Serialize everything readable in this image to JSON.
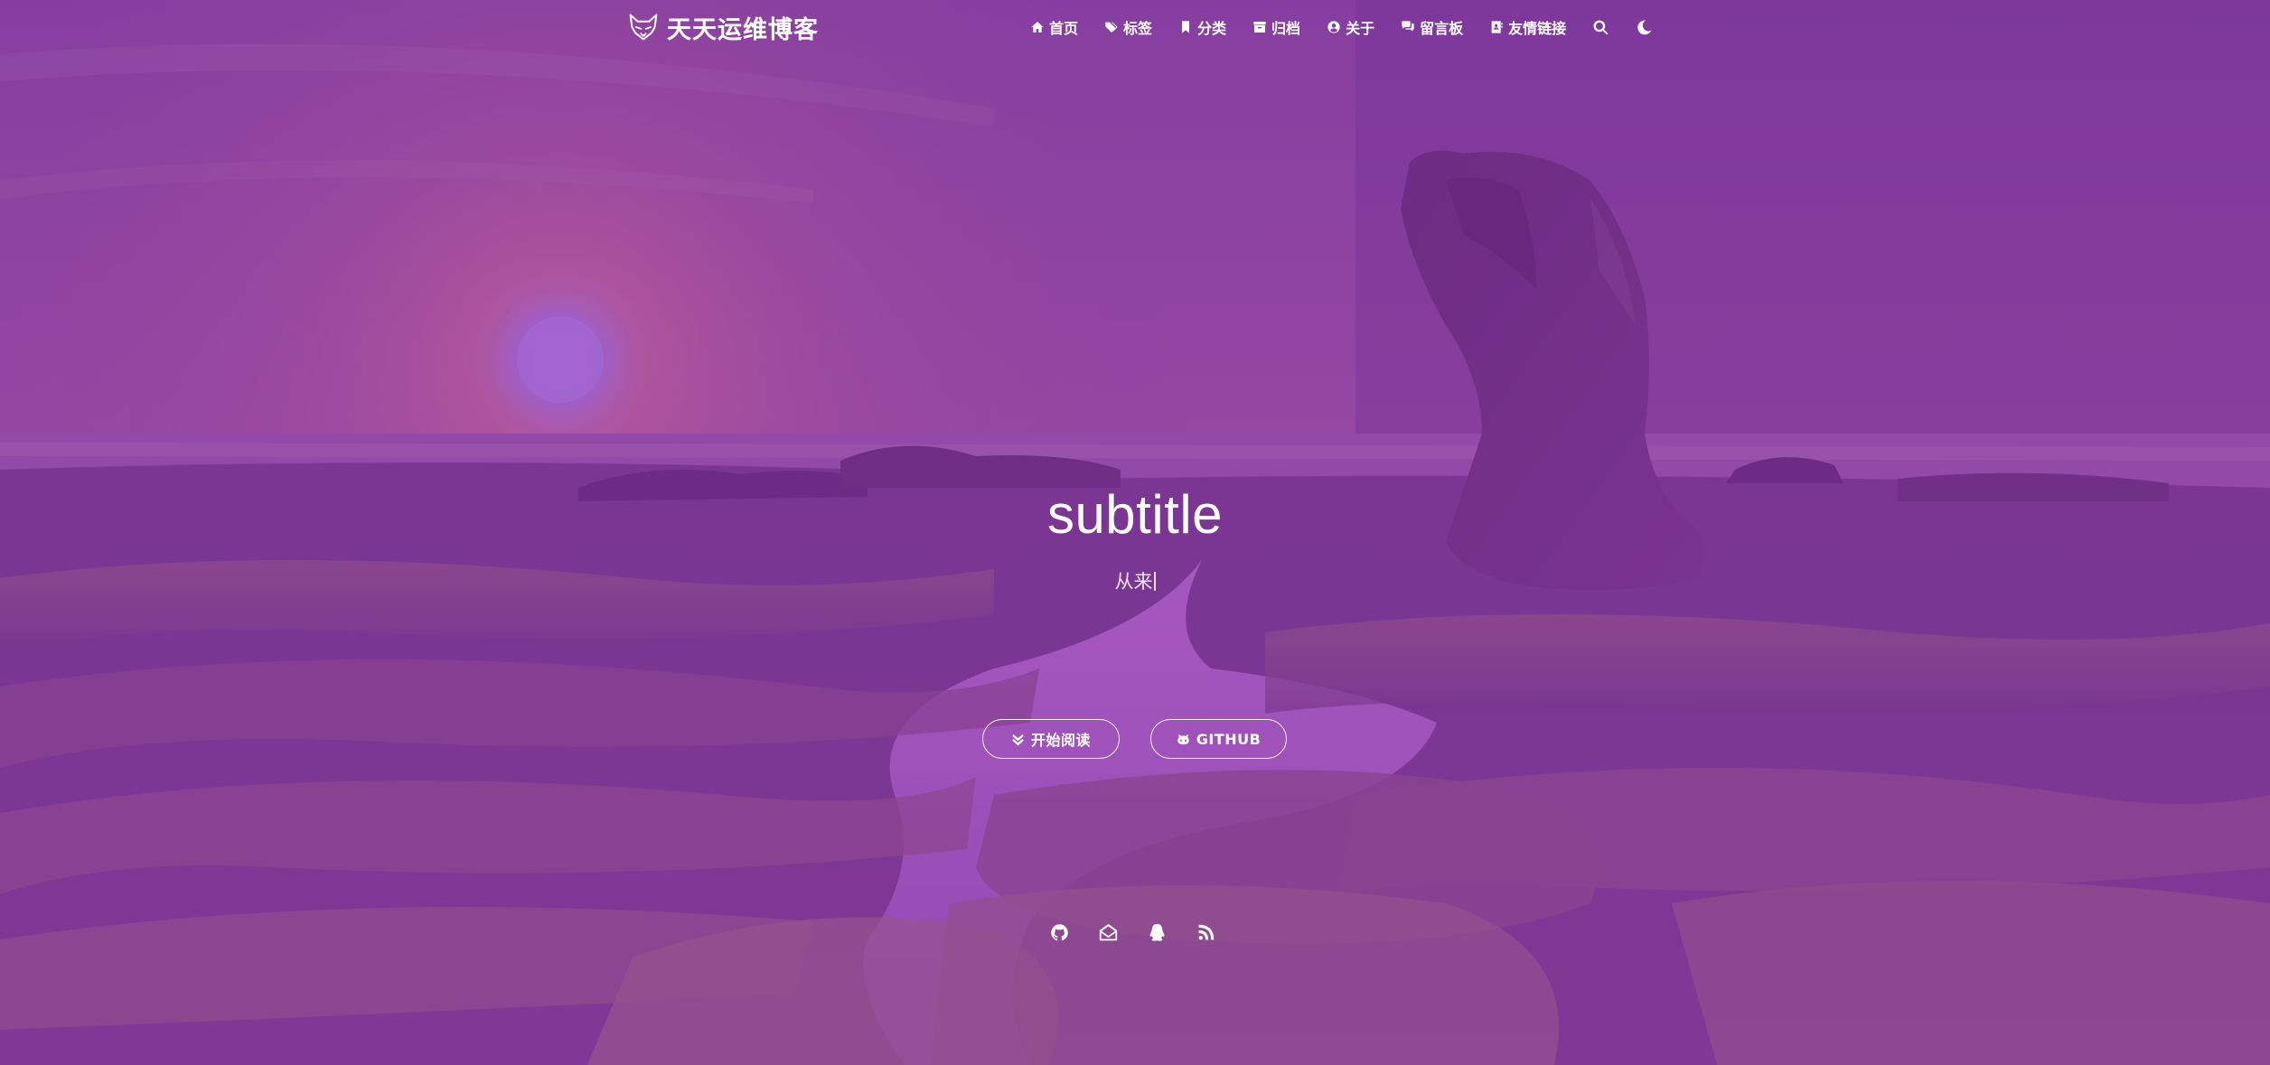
{
  "brand": {
    "title": "天天运维博客"
  },
  "nav": {
    "items": [
      {
        "label": "首页",
        "icon": "home-icon"
      },
      {
        "label": "标签",
        "icon": "tags-icon"
      },
      {
        "label": "分类",
        "icon": "bookmark-icon"
      },
      {
        "label": "归档",
        "icon": "archive-icon"
      },
      {
        "label": "关于",
        "icon": "user-circle-icon"
      },
      {
        "label": "留言板",
        "icon": "comments-icon"
      },
      {
        "label": "友情链接",
        "icon": "address-book-icon"
      }
    ],
    "search_icon": "search-icon",
    "theme_icon": "moon-icon"
  },
  "hero": {
    "title": "subtitle",
    "subtitle": "从来",
    "buttons": {
      "read_label": "开始阅读",
      "github_label": "GITHUB"
    }
  },
  "social": [
    "github-icon",
    "envelope-open-icon",
    "qq-icon",
    "rss-icon"
  ],
  "colors": {
    "sky_top": "#7a3a9a",
    "sky_glow": "#d06aa8",
    "sun": "#b070e0",
    "rock": "#6e2e82",
    "ground": "#7d3a92",
    "water": "#a85cc8"
  }
}
